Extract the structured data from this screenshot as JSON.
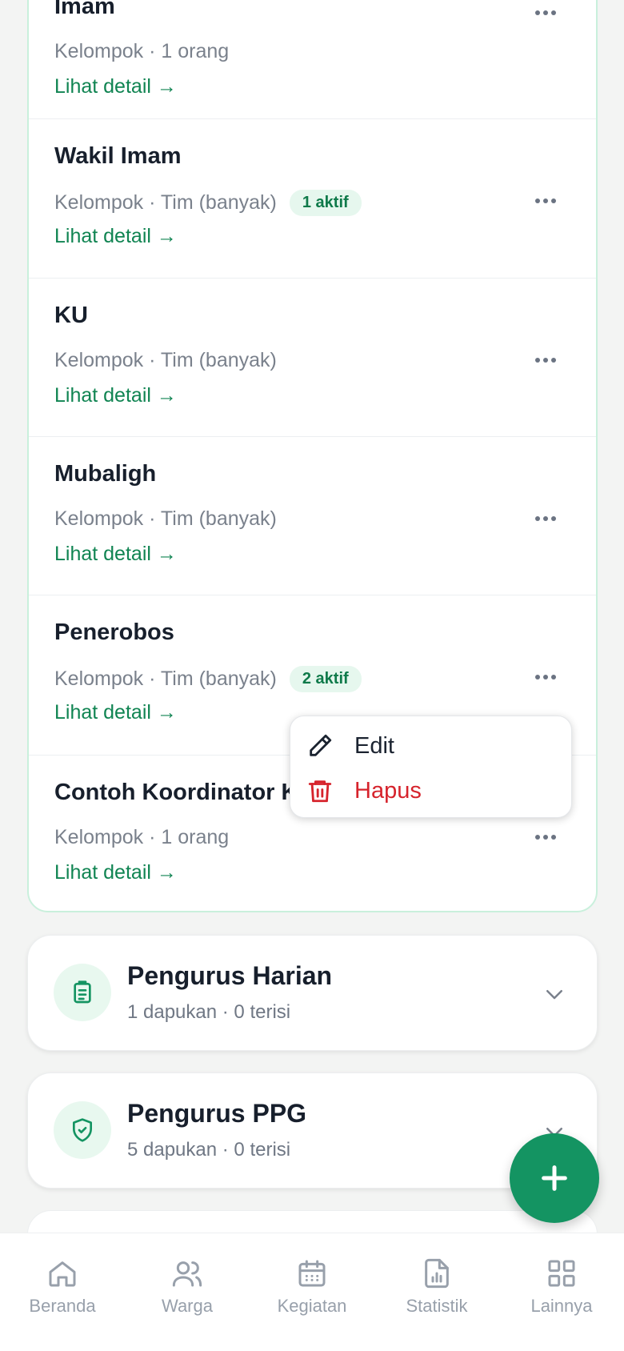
{
  "groups": [
    {
      "title": "Imam",
      "meta": "Kelompok · 1 orang",
      "badge": "",
      "link": "Lihat detail →"
    },
    {
      "title": "Wakil Imam",
      "meta": "Kelompok · Tim (banyak)",
      "badge": "1 aktif",
      "link": "Lihat detail →"
    },
    {
      "title": "KU",
      "meta": "Kelompok · Tim (banyak)",
      "badge": "",
      "link": "Lihat detail →"
    },
    {
      "title": "Mubaligh",
      "meta": "Kelompok · Tim (banyak)",
      "badge": "",
      "link": "Lihat detail →"
    },
    {
      "title": "Penerobos",
      "meta": "Kelompok · Tim (banyak)",
      "badge": "2 aktif",
      "link": "Lihat detail →"
    },
    {
      "title": "Contoh Koordinator Ke",
      "meta": "Kelompok · 1 orang",
      "badge": "",
      "link": "Lihat detail →"
    }
  ],
  "popup": {
    "edit": "Edit",
    "delete": "Hapus"
  },
  "sections": [
    {
      "title": "Pengurus Harian",
      "sub": "1 dapukan · 0 terisi",
      "icon": "clipboard-icon"
    },
    {
      "title": "Pengurus PPG",
      "sub": "5 dapukan · 0 terisi",
      "icon": "shield-check-icon"
    }
  ],
  "nav": [
    {
      "label": "Beranda",
      "icon": "home-icon"
    },
    {
      "label": "Warga",
      "icon": "users-icon"
    },
    {
      "label": "Kegiatan",
      "icon": "calendar-icon"
    },
    {
      "label": "Statistik",
      "icon": "chart-file-icon"
    },
    {
      "label": "Lainnya",
      "icon": "grid-icon"
    }
  ],
  "colors": {
    "accent": "#149462",
    "link": "#108452",
    "danger": "#d6232c",
    "badge_bg": "#e6f7ee"
  }
}
